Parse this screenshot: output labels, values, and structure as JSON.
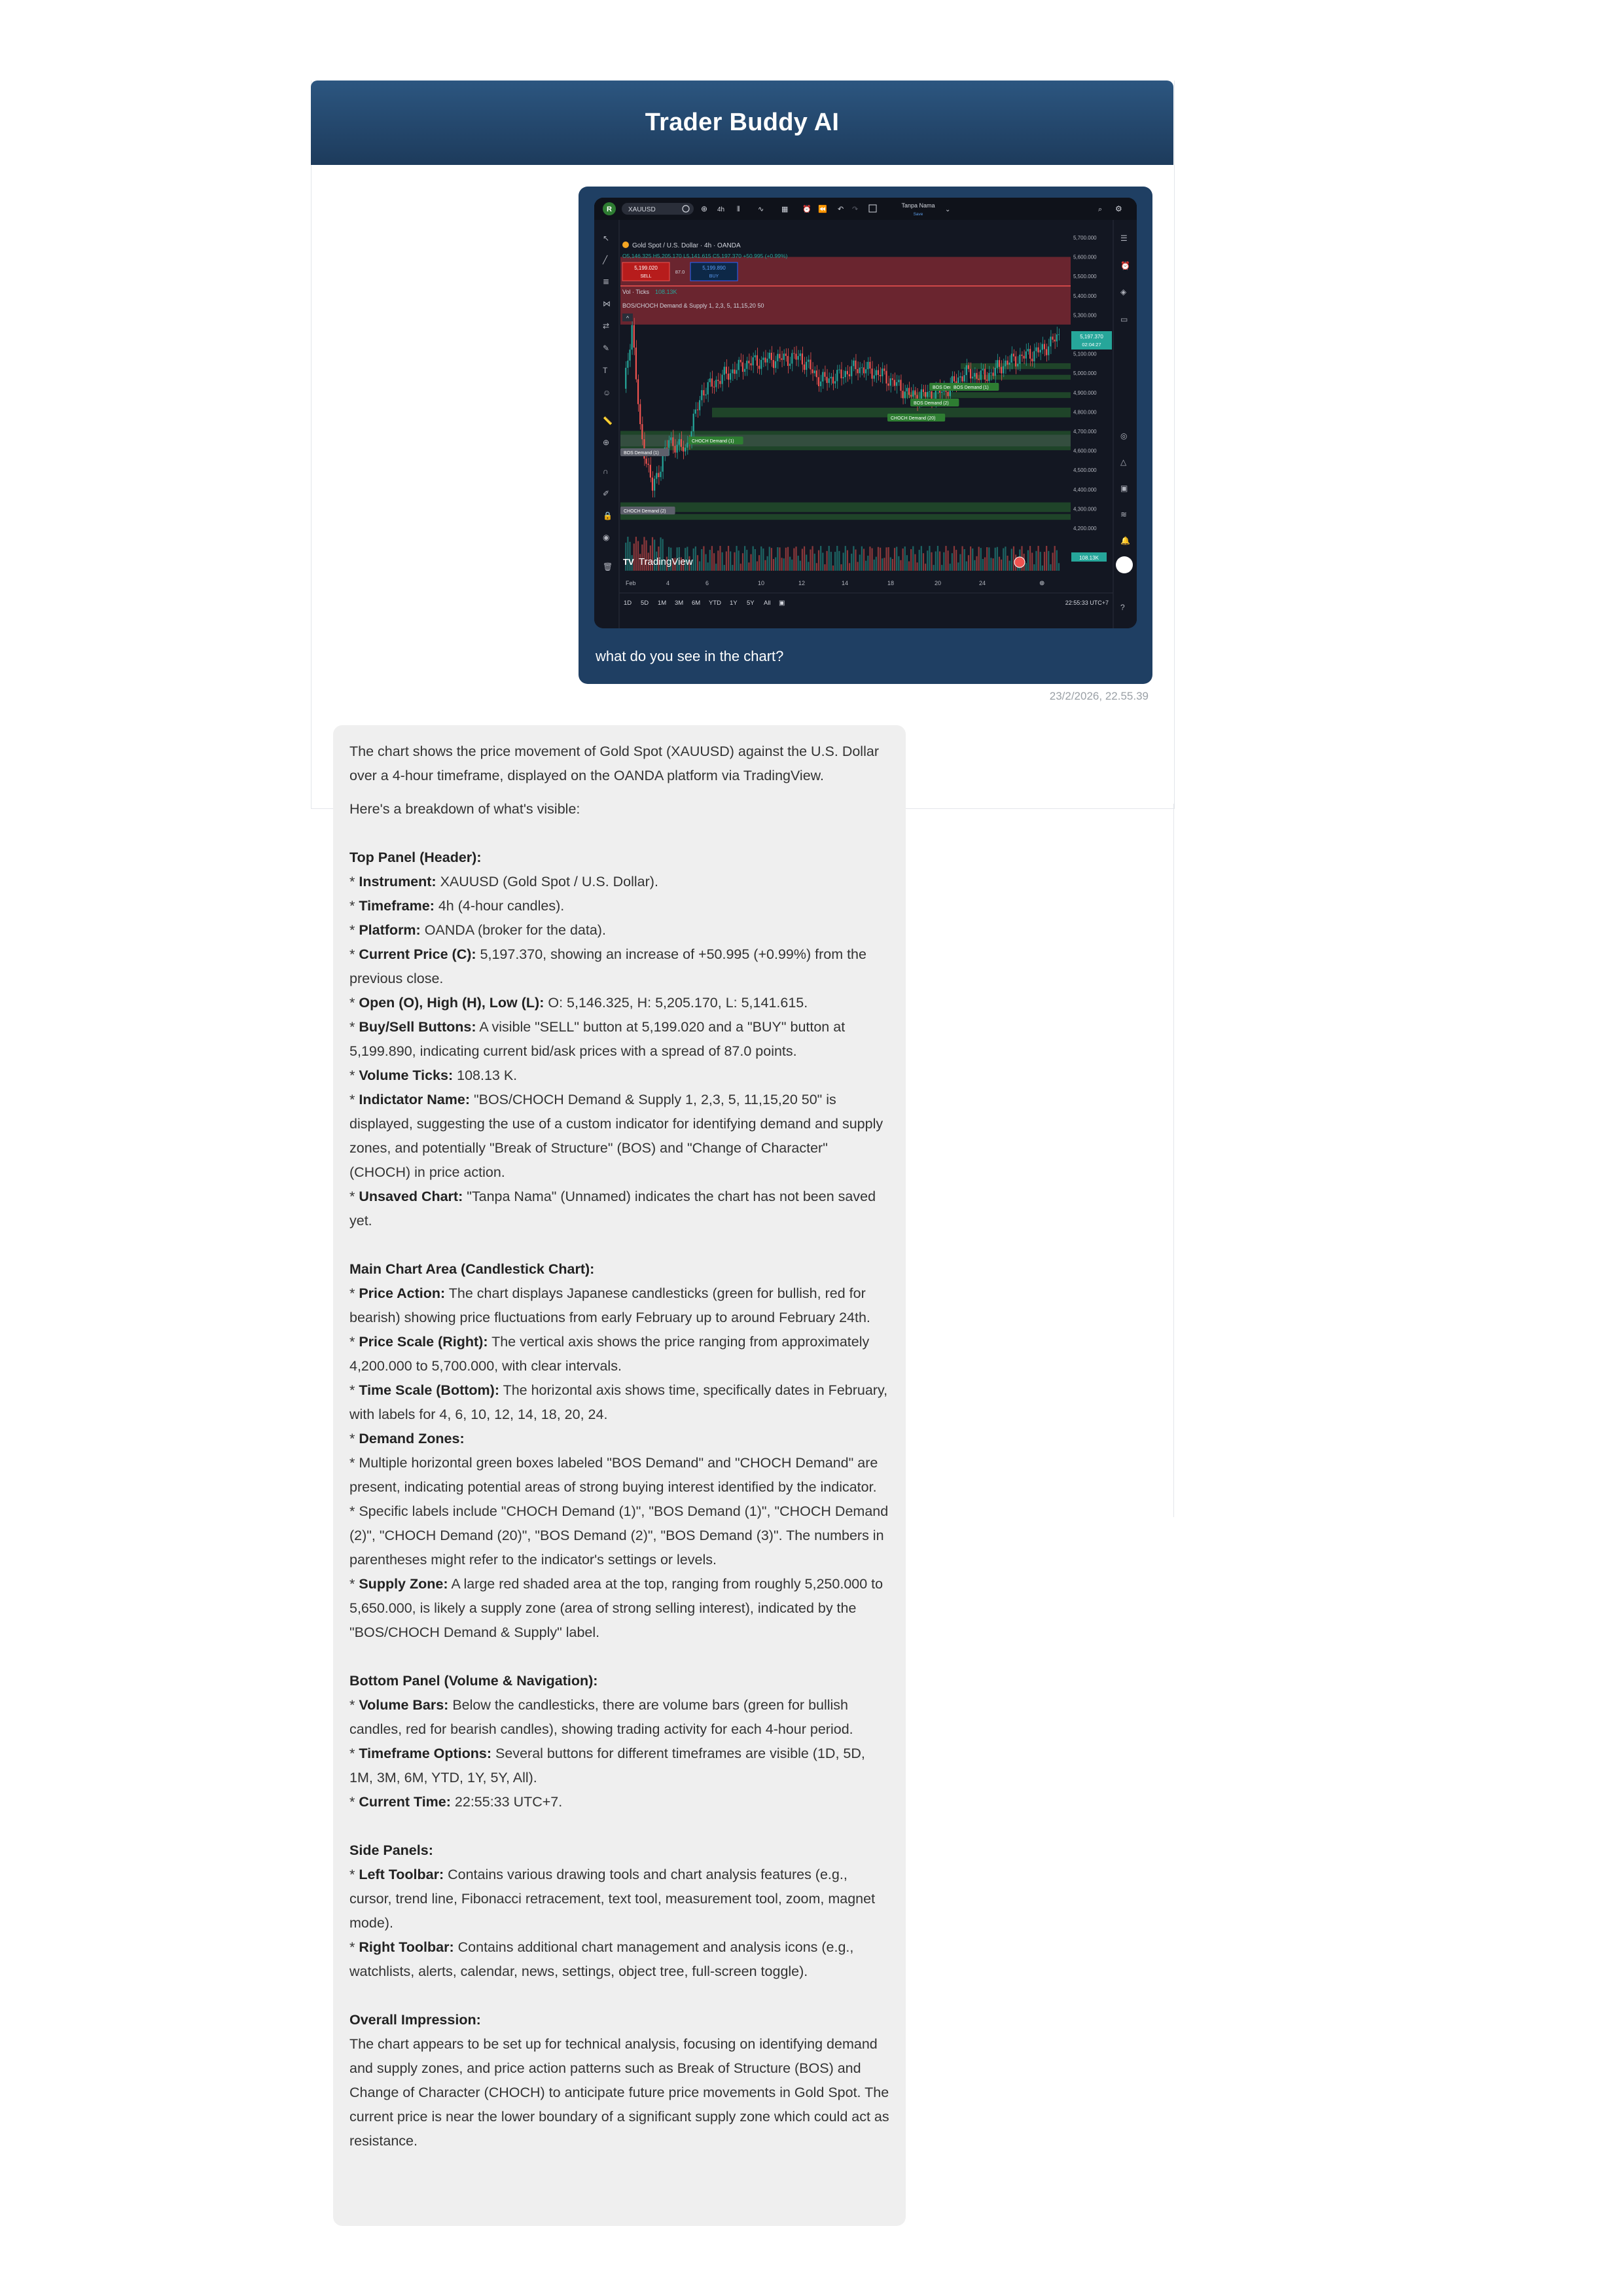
{
  "app": {
    "title": "Trader Buddy AI"
  },
  "chat": {
    "user_message": "what do you see in the chart?",
    "timestamp": "23/2/2026, 22.55.39",
    "attachment": {
      "symbol": "XAUUSD",
      "avatar_letter": "R",
      "toolbar_interval": "4h",
      "layout_name": "Tanpa Nama",
      "layout_status": "Save",
      "legend_title": "Gold Spot / U.S. Dollar · 4h · OANDA",
      "legend_ohlc": "O5,146.325 H5,205.170 L5,141.615 C5,197.370 +50.995 (+0.99%)",
      "sell_price": "5,199.020",
      "sell_label": "SELL",
      "spread": "87.0",
      "buy_price": "5,199.890",
      "buy_label": "BUY",
      "vol_label": "Vol · Ticks",
      "vol_value": "108.13K",
      "indicator_label": "BOS/CHOCH Demand & Supply 1, 2,3, 5, 11,15,20 50",
      "price_ticks": [
        "5,700.000",
        "5,600.000",
        "5,500.000",
        "5,400.000",
        "5,300.000",
        "5,200.000",
        "5,100.000",
        "5,000.000",
        "4,900.000",
        "4,800.000",
        "4,700.000",
        "4,600.000",
        "4,500.000",
        "4,400.000",
        "4,300.000",
        "4,200.000"
      ],
      "current_price": "5,197.370",
      "countdown": "02:04:27",
      "volume_badge": "108.13K",
      "date_ticks": [
        "Feb",
        "4",
        "6",
        "10",
        "12",
        "14",
        "18",
        "20",
        "24"
      ],
      "timeframes": [
        "1D",
        "5D",
        "1M",
        "3M",
        "6M",
        "YTD",
        "1Y",
        "5Y",
        "All"
      ],
      "clock": "22:55:33 UTC+7",
      "watermark": "TradingView",
      "zone_labels": [
        "BOS Demand (1)",
        "CHOCH Demand (1)",
        "CHOCH Demand (20)",
        "BOS Demand (2)",
        "BOS Demand (3)",
        "BOS Demand (1)",
        "CHOCH Demand (2)"
      ],
      "colors": {
        "bg": "#131722",
        "up": "#26a69a",
        "down": "#ef5350",
        "supply": "#b2323a",
        "demand": "#2e7d32"
      }
    },
    "bot_reply": {
      "intro": "The chart shows the price movement of Gold Spot (XAUUSD) against the U.S. Dollar over a 4-hour timeframe, displayed on the OANDA platform via TradingView.",
      "breakdown": "Here's a breakdown of what's visible:",
      "sections": [
        {
          "heading": "Top Panel (Header):",
          "items": [
            {
              "label": "Instrument:",
              "text": "XAUUSD (Gold Spot / U.S. Dollar)."
            },
            {
              "label": "Timeframe:",
              "text": "4h (4-hour candles)."
            },
            {
              "label": "Platform:",
              "text": "OANDA (broker for the data)."
            },
            {
              "label": "Current Price (C):",
              "text": "5,197.370, showing an increase of +50.995 (+0.99%) from the previous close."
            },
            {
              "label": "Open (O), High (H), Low (L):",
              "text": "O: 5,146.325, H: 5,205.170, L: 5,141.615."
            },
            {
              "label": "Buy/Sell Buttons:",
              "text": "A visible \"SELL\" button at 5,199.020 and a \"BUY\" button at 5,199.890, indicating current bid/ask prices with a spread of 87.0 points."
            },
            {
              "label": "Volume Ticks:",
              "text": "108.13 K."
            },
            {
              "label": "Indictator Name:",
              "text": "\"BOS/CHOCH Demand & Supply 1, 2,3, 5, 11,15,20 50\" is displayed, suggesting the use of a custom indicator for identifying demand and supply zones, and potentially \"Break of Structure\" (BOS) and \"Change of Character\" (CHOCH) in price action."
            },
            {
              "label": "Unsaved Chart:",
              "text": "\"Tanpa Nama\" (Unnamed) indicates the chart has not been saved yet."
            }
          ]
        },
        {
          "heading": "Main Chart Area (Candlestick Chart):",
          "items": [
            {
              "label": "Price Action:",
              "text": "The chart displays Japanese candlesticks (green for bullish, red for bearish) showing price fluctuations from early February up to around February 24th."
            },
            {
              "label": "Price Scale (Right):",
              "text": "The vertical axis shows the price ranging from approximately 4,200.000 to 5,700.000, with clear intervals."
            },
            {
              "label": "Time Scale (Bottom):",
              "text": "The horizontal axis shows time, specifically dates in February, with labels for 4, 6, 10, 12, 14, 18, 20, 24."
            },
            {
              "label": "Demand Zones:",
              "text": ""
            },
            {
              "label": "",
              "text": "Multiple horizontal green boxes labeled \"BOS Demand\" and \"CHOCH Demand\" are present, indicating potential areas of strong buying interest identified by the indicator."
            },
            {
              "label": "",
              "text": "Specific labels include \"CHOCH Demand (1)\", \"BOS Demand (1)\", \"CHOCH Demand (2)\", \"CHOCH Demand (20)\", \"BOS Demand (2)\", \"BOS Demand (3)\". The numbers in parentheses might refer to the indicator's settings or levels."
            },
            {
              "label": "Supply Zone:",
              "text": "A large red shaded area at the top, ranging from roughly 5,250.000 to 5,650.000, is likely a supply zone (area of strong selling interest), indicated by the \"BOS/CHOCH Demand & Supply\" label."
            }
          ]
        },
        {
          "heading": "Bottom Panel (Volume & Navigation):",
          "items": [
            {
              "label": "Volume Bars:",
              "text": "Below the candlesticks, there are volume bars (green for bullish candles, red for bearish candles), showing trading activity for each 4-hour period."
            },
            {
              "label": "Timeframe Options:",
              "text": "Several buttons for different timeframes are visible (1D, 5D, 1M, 3M, 6M, YTD, 1Y, 5Y, All)."
            },
            {
              "label": "Current Time:",
              "text": "22:55:33 UTC+7."
            }
          ]
        },
        {
          "heading": "Side Panels:",
          "items": [
            {
              "label": "Left Toolbar:",
              "text": "Contains various drawing tools and chart analysis features (e.g., cursor, trend line, Fibonacci retracement, text tool, measurement tool, zoom, magnet mode)."
            },
            {
              "label": "Right Toolbar:",
              "text": "Contains additional chart management and analysis icons (e.g., watchlists, alerts, calendar, news, settings, object tree, full-screen toggle)."
            }
          ]
        }
      ],
      "overall_heading": "Overall Impression:",
      "overall_text": "The chart appears to be set up for technical analysis, focusing on identifying demand and supply zones, and price action patterns such as Break of Structure (BOS) and Change of Character (CHOCH) to anticipate future price movements in Gold Spot. The current price is near the lower boundary of a significant supply zone which could act as resistance."
    }
  }
}
